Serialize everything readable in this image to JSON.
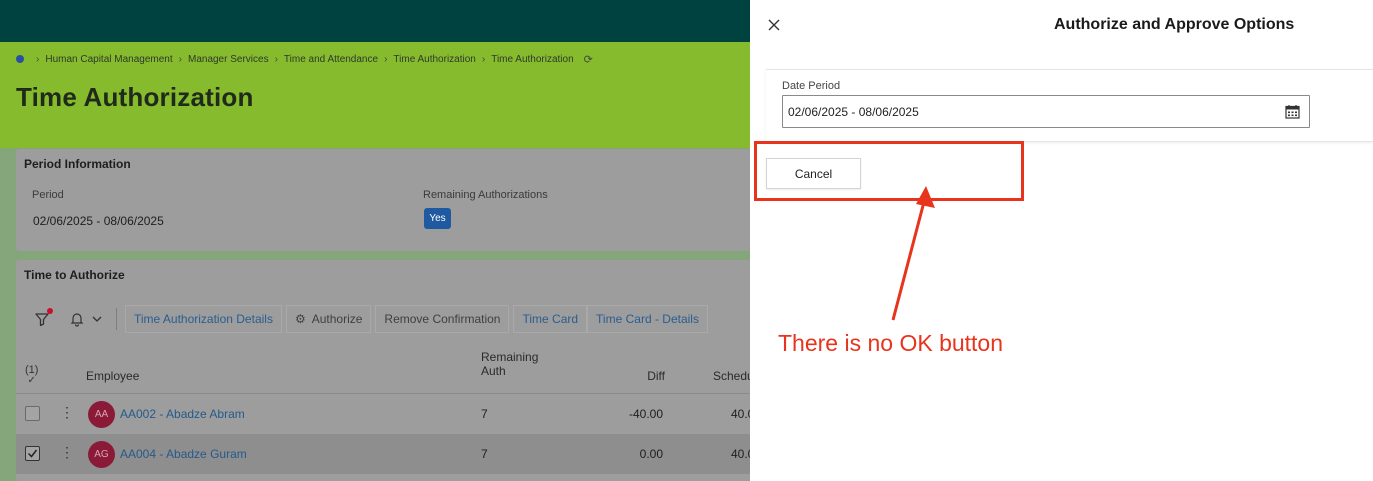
{
  "breadcrumb": {
    "items": [
      "Human Capital Management",
      "Manager Services",
      "Time and Attendance",
      "Time Authorization",
      "Time Authorization"
    ]
  },
  "page": {
    "title": "Time Authorization"
  },
  "period_info": {
    "title": "Period Information",
    "period_label": "Period",
    "period_value": "02/06/2025 - 08/06/2025",
    "remaining_label": "Remaining Authorizations",
    "remaining_value": "Yes"
  },
  "time_to_authorize": {
    "title": "Time to Authorize",
    "toolbar": {
      "details_label": "Time Authorization Details",
      "authorize_label": "Authorize",
      "remove_label": "Remove Confirmation",
      "timecard_label": "Time Card",
      "timecard_details_label": "Time Card - Details"
    },
    "grid": {
      "selected_count": "(1)",
      "columns": {
        "employee": "Employee",
        "remaining_line1": "Remaining",
        "remaining_line2": "Auth",
        "diff": "Diff",
        "scheduled": "Schedu"
      },
      "rows": [
        {
          "initials": "AA",
          "name": "AA002 - Abadze Abram",
          "remaining": "7",
          "diff": "-40.00",
          "scheduled": "40.0",
          "checked": false
        },
        {
          "initials": "AG",
          "name": "AA004 - Abadze Guram",
          "remaining": "7",
          "diff": "0.00",
          "scheduled": "40.0",
          "checked": true
        }
      ]
    }
  },
  "panel": {
    "title": "Authorize and Approve Options",
    "date_period_label": "Date Period",
    "date_period_value": "02/06/2025 - 08/06/2025",
    "cancel_label": "Cancel"
  },
  "annotation": {
    "text": "There is no OK button",
    "color": "#e8341c"
  },
  "colors": {
    "topbar": "#00423f",
    "accent_green": "#87bb2e",
    "link_blue": "#255a8a",
    "badge_blue": "#1f5aa0",
    "avatar_bg": "#8b1a39"
  }
}
